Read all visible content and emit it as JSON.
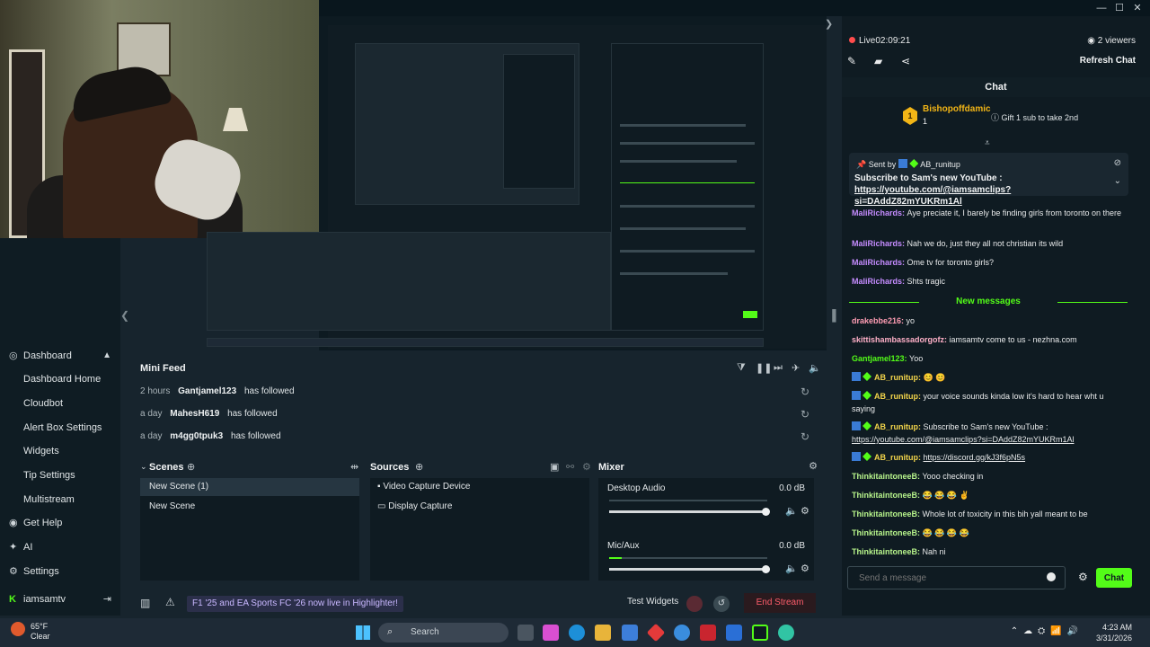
{
  "webcam": {
    "description_icon": "webcam-feed"
  },
  "window": {
    "minimize": "—",
    "maximize": "☐",
    "close": "✕"
  },
  "sidebar": {
    "items": [
      {
        "label": "Dashboard",
        "icon": "dashboard-icon"
      },
      {
        "label": "Dashboard Home"
      },
      {
        "label": "Cloudbot"
      },
      {
        "label": "Alert Box Settings"
      },
      {
        "label": "Widgets"
      },
      {
        "label": "Tip Settings"
      },
      {
        "label": "Multistream"
      },
      {
        "label": "Get Help",
        "icon": "help-icon"
      },
      {
        "label": "AI",
        "icon": "ai-icon"
      },
      {
        "label": "Settings",
        "icon": "gear-icon"
      }
    ],
    "user": "iamsamtv"
  },
  "minifeed": {
    "title": "Mini Feed",
    "rows": [
      {
        "time": "2 hours",
        "user": "Gantjamel123",
        "action": "has followed"
      },
      {
        "time": "a day",
        "user": "MahesH619",
        "action": "has followed"
      },
      {
        "time": "a day",
        "user": "m4gg0tpuk3",
        "action": "has followed"
      }
    ]
  },
  "scenes": {
    "title": "Scenes",
    "items": [
      "New Scene (1)",
      "New Scene"
    ]
  },
  "sources": {
    "title": "Sources",
    "items": [
      "Video Capture Device",
      "Display Capture"
    ]
  },
  "mixer": {
    "title": "Mixer",
    "channels": [
      {
        "name": "Desktop Audio",
        "db": "0.0 dB",
        "level": 0.0
      },
      {
        "name": "Mic/Aux",
        "db": "0.0 dB",
        "level": 0.08
      }
    ]
  },
  "statusbar": {
    "banner": "F1 '25 and EA Sports FC '26 now live in Highlighter!",
    "test_widgets": "Test Widgets",
    "end_stream": "End Stream"
  },
  "chat": {
    "live_label": "Live",
    "live_time": "02:09:21",
    "viewers": "2 viewers",
    "refresh": "Refresh Chat",
    "header": "Chat",
    "gift_user": "Bishopoffdamic",
    "gift_count": "1",
    "gift_badge": "1",
    "gift_text": "Gift 1 sub to take 2nd",
    "pinned_prefix": "Sent by",
    "pinned_user": "AB_runitup",
    "pinned_text": "Subscribe to Sam's new YouTube :",
    "pinned_link": "https://youtube.com/@iamsamclips?si=DAddZ82mYUKRm1Al",
    "messages_before": [
      {
        "user": "MaliRichards",
        "color": "#c58cff",
        "text": "Aye preciate it, I barely be finding girls from toronto on there"
      },
      {
        "user": "MaliRichards",
        "color": "#c58cff",
        "text": "Nah we do, just they all not christian its wild"
      },
      {
        "user": "MaliRichards",
        "color": "#c58cff",
        "text": "Ome tv for toronto girls?"
      },
      {
        "user": "MaliRichards",
        "color": "#c58cff",
        "text": "Shts tragic"
      }
    ],
    "new_messages": "New messages",
    "messages_after": [
      {
        "user": "drakebbe216",
        "color": "#ff9db4",
        "text": "yo"
      },
      {
        "user": "skittishambassadorgofz",
        "color": "#ffb0c8",
        "text": "iamsamtv come to us - nezhna.com"
      },
      {
        "user": "Gantjamel123",
        "color": "#53fc18",
        "text": "Yoo"
      },
      {
        "user": "AB_runitup",
        "color": "#f2d44a",
        "text": "😊 😊",
        "badges": true
      },
      {
        "user": "AB_runitup",
        "color": "#f2d44a",
        "text": "your voice sounds kinda low it's hard to hear wht u saying",
        "badges": true
      },
      {
        "user": "AB_runitup",
        "color": "#f2d44a",
        "text": "Subscribe to Sam's new YouTube :",
        "link": "https://youtube.com/@iamsamclips?si=DAddZ82mYUKRm1Al",
        "badges": true
      },
      {
        "user": "AB_runitup",
        "color": "#f2d44a",
        "text": "",
        "link": "https://discord.gg/kJ3f6pN5s",
        "badges": true
      },
      {
        "user": "ThinkitaintoneeB",
        "color": "#b8f58c",
        "text": "Yooo checking in"
      },
      {
        "user": "ThinkitaintoneeB",
        "color": "#b8f58c",
        "text": "😂 😂 😂 ✌"
      },
      {
        "user": "ThinkitaintoneeB",
        "color": "#b8f58c",
        "text": "Whole lot of toxicity in this bih yall meant to be"
      },
      {
        "user": "ThinkitaintoneeB",
        "color": "#b8f58c",
        "text": "😂 😂 😂 😂"
      },
      {
        "user": "ThinkitaintoneeB",
        "color": "#b8f58c",
        "text": "Nah ni"
      }
    ],
    "input_placeholder": "Send a message",
    "send_label": "Chat"
  },
  "taskbar": {
    "temp": "65°F",
    "condition": "Clear",
    "search": "Search",
    "time": "4:23 AM",
    "date": "3/31/2026"
  },
  "colors": {
    "accent": "#53fc18",
    "live": "#ff4c4c",
    "end_stream": "#ff5d6b"
  }
}
